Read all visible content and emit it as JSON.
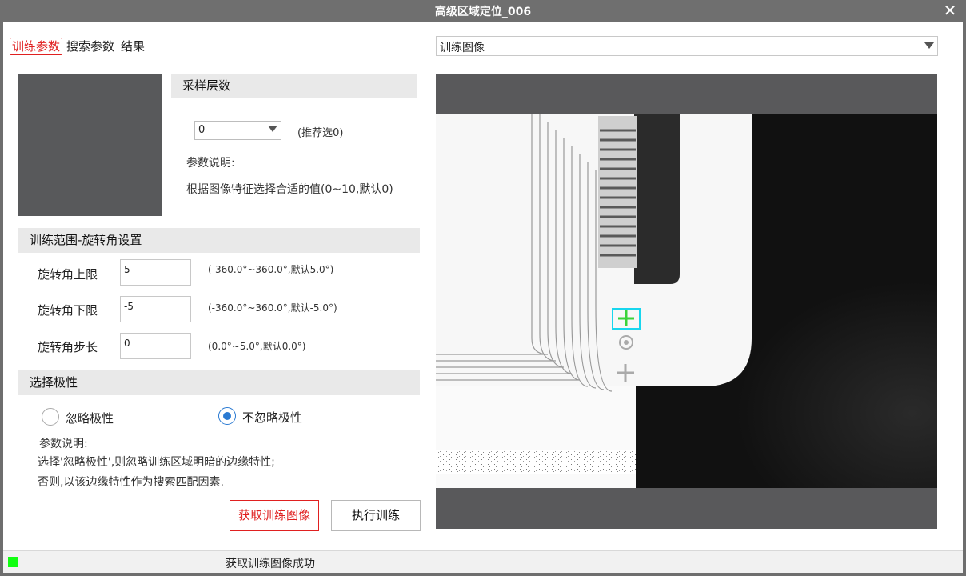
{
  "window": {
    "title": "高级区域定位_006",
    "close_icon": "close-icon"
  },
  "tabs": [
    {
      "label": "训练参数",
      "active": true
    },
    {
      "label": "搜索参数",
      "active": false
    },
    {
      "label": "结果",
      "active": false
    }
  ],
  "sampling": {
    "header": "采样层数",
    "value": "0",
    "recommend": "(推荐选0)",
    "desc_title": "参数说明:",
    "desc_text": "根据图像特征选择合适的值(0~10,默认0)"
  },
  "rotation": {
    "header": "训练范围-旋转角设置",
    "rows": [
      {
        "label": "旋转角上限",
        "value": "5",
        "hint": "(-360.0°~360.0°,默认5.0°)"
      },
      {
        "label": "旋转角下限",
        "value": "-5",
        "hint": "(-360.0°~360.0°,默认-5.0°)"
      },
      {
        "label": "旋转角步长",
        "value": "0",
        "hint": "(0.0°~5.0°,默认0.0°)"
      }
    ]
  },
  "polarity": {
    "header": "选择极性",
    "options": [
      {
        "label": "忽略极性",
        "selected": false
      },
      {
        "label": "不忽略极性",
        "selected": true
      }
    ],
    "desc_title": "参数说明:",
    "desc_line1": "选择'忽略极性',则忽略训练区域明暗的边缘特性;",
    "desc_line2": "否则,以该边缘特性作为搜索匹配因素."
  },
  "buttons": {
    "capture": "获取训练图像",
    "train": "执行训练"
  },
  "image_view": {
    "source": "训练图像"
  },
  "status": {
    "text": "获取训练图像成功",
    "led_color": "#11ff11"
  },
  "colors": {
    "accent_red": "#e02020",
    "radio_blue": "#2a7ad2",
    "roi_cyan": "#18d6ee",
    "marker_green": "#3ad33a"
  }
}
